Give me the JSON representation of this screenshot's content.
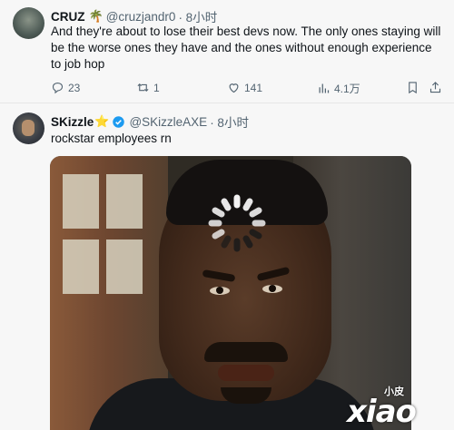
{
  "tweet1": {
    "name": "CRUZ",
    "emoji": "🌴",
    "handle": "@cruzjandr0",
    "time": "· 8小时",
    "text": "And they're about to lose their best devs now. The only ones staying will be the worse ones they have and the ones without enough experience to job hop",
    "actions": {
      "replies": "23",
      "reposts": "1",
      "likes": "141",
      "views": "4.1万"
    }
  },
  "tweet2": {
    "name": "SKizzle",
    "emoji": "⭐",
    "handle": "@SKizzleAXE",
    "time": "· 8小时",
    "text": "rockstar employees rn"
  },
  "watermark": {
    "cn": "小皮",
    "logo": "xiao"
  },
  "colors": {
    "text": "#0f1419",
    "muted": "#536471",
    "verified": "#1d9bf0",
    "background": "#f7f7f7"
  }
}
